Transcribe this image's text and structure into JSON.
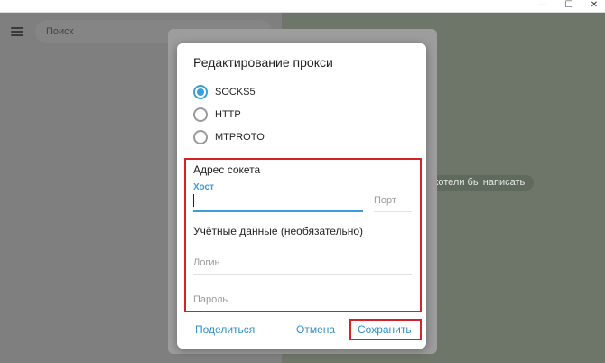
{
  "window": {
    "min_glyph": "—",
    "max_glyph": "☐",
    "close_glyph": "✕"
  },
  "app": {
    "search_placeholder": "Поиск",
    "chat_hint": "хотели бы написать"
  },
  "dialog": {
    "title": "Редактирование прокси",
    "types": [
      {
        "label": "SOCKS5",
        "checked": true
      },
      {
        "label": "HTTP",
        "checked": false
      },
      {
        "label": "MTPROTO",
        "checked": false
      }
    ],
    "socket_section": "Адрес сокета",
    "host_label": "Хост",
    "host_value": "",
    "port_placeholder": "Порт",
    "credentials_section": "Учётные данные (необязательно)",
    "login_placeholder": "Логин",
    "password_placeholder": "Пароль",
    "share_label": "Поделиться",
    "cancel_label": "Отмена",
    "save_label": "Сохранить"
  },
  "colors": {
    "accent": "#3a9fd8",
    "highlight": "#d2232a"
  }
}
